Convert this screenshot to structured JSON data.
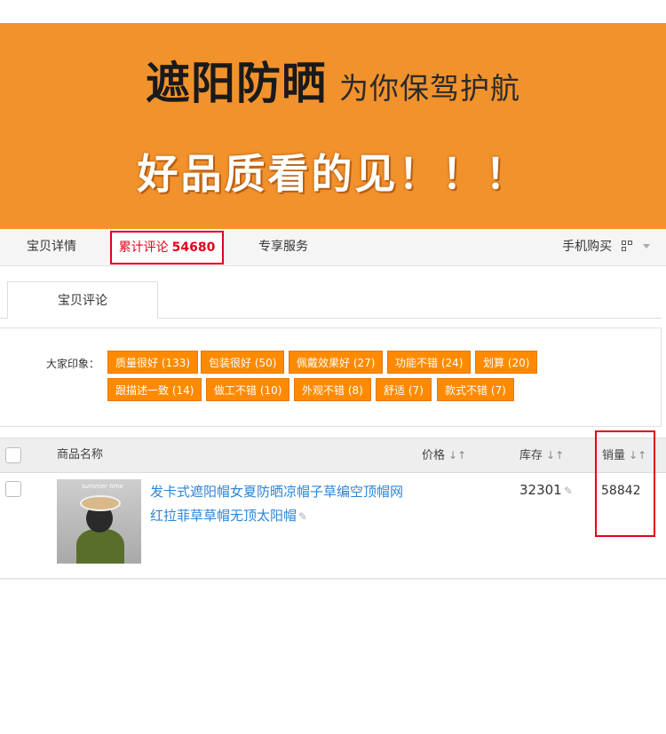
{
  "banner": {
    "title": "遮阳防晒",
    "subtitle": "为你保驾护航",
    "slogan": "好品质看的见！！！"
  },
  "tabs": {
    "detail": "宝贝详情",
    "reviews_label": "累计评论",
    "reviews_count": "54680",
    "service": "专享服务",
    "mobile_buy": "手机购买"
  },
  "subtab": {
    "label": "宝贝评论"
  },
  "impressions": {
    "label": "大家印象：",
    "tags": [
      "质量很好 (133)",
      "包装很好 (50)",
      "佩戴效果好 (27)",
      "功能不错 (24)",
      "划算 (20)",
      "跟描述一致 (14)",
      "做工不错 (10)",
      "外观不错 (8)",
      "舒适 (7)",
      "款式不错 (7)"
    ]
  },
  "table": {
    "headers": {
      "name": "商品名称",
      "price": "价格",
      "stock": "库存",
      "sales": "销量"
    },
    "rows": [
      {
        "thumb_caption": "summer time",
        "title": "发卡式遮阳帽女夏防晒凉帽子草编空顶帽网红拉菲草草帽无顶太阳帽",
        "stock": "32301",
        "sales": "58842"
      }
    ]
  },
  "colors": {
    "banner_bg": "#f2922c",
    "tag_bg": "#ff8a00",
    "highlight_red": "#e3001b",
    "link_blue": "#2e84d6"
  }
}
